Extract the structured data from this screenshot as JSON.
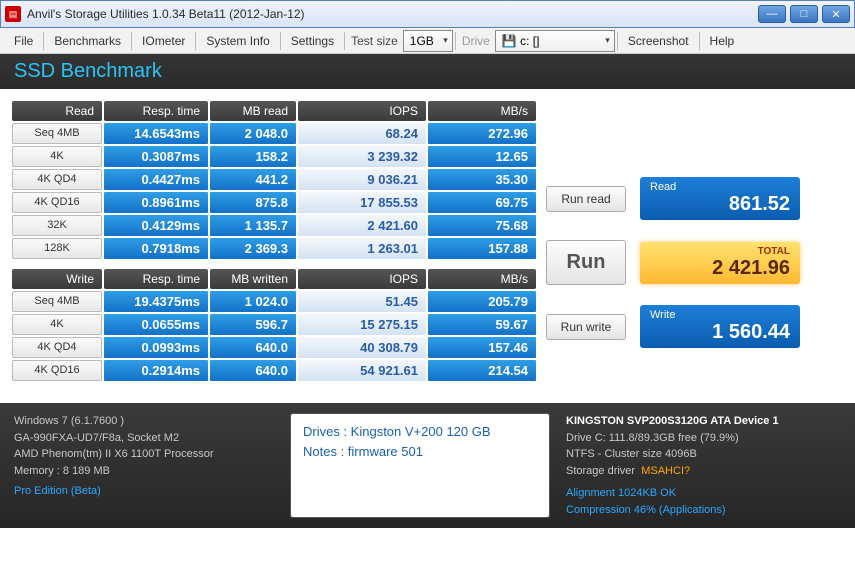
{
  "window": {
    "title": "Anvil's Storage Utilities 1.0.34 Beta11 (2012-Jan-12)"
  },
  "menu": {
    "file": "File",
    "benchmarks": "Benchmarks",
    "iometer": "IOmeter",
    "sysinfo": "System Info",
    "settings": "Settings",
    "testsize_label": "Test size",
    "testsize_value": "1GB",
    "drive_label": "Drive",
    "drive_value": "💾 c: []",
    "screenshot": "Screenshot",
    "help": "Help"
  },
  "section_title": "SSD Benchmark",
  "read_table": {
    "headers": {
      "c0": "Read",
      "c1": "Resp. time",
      "c2": "MB read",
      "c3": "IOPS",
      "c4": "MB/s"
    },
    "rows": [
      {
        "label": "Seq 4MB",
        "resp": "14.6543ms",
        "mb": "2 048.0",
        "iops": "68.24",
        "mbs": "272.96"
      },
      {
        "label": "4K",
        "resp": "0.3087ms",
        "mb": "158.2",
        "iops": "3 239.32",
        "mbs": "12.65"
      },
      {
        "label": "4K QD4",
        "resp": "0.4427ms",
        "mb": "441.2",
        "iops": "9 036.21",
        "mbs": "35.30"
      },
      {
        "label": "4K QD16",
        "resp": "0.8961ms",
        "mb": "875.8",
        "iops": "17 855.53",
        "mbs": "69.75"
      },
      {
        "label": "32K",
        "resp": "0.4129ms",
        "mb": "1 135.7",
        "iops": "2 421.60",
        "mbs": "75.68"
      },
      {
        "label": "128K",
        "resp": "0.7918ms",
        "mb": "2 369.3",
        "iops": "1 263.01",
        "mbs": "157.88"
      }
    ]
  },
  "write_table": {
    "headers": {
      "c0": "Write",
      "c1": "Resp. time",
      "c2": "MB written",
      "c3": "IOPS",
      "c4": "MB/s"
    },
    "rows": [
      {
        "label": "Seq 4MB",
        "resp": "19.4375ms",
        "mb": "1 024.0",
        "iops": "51.45",
        "mbs": "205.79"
      },
      {
        "label": "4K",
        "resp": "0.0655ms",
        "mb": "596.7",
        "iops": "15 275.15",
        "mbs": "59.67"
      },
      {
        "label": "4K QD4",
        "resp": "0.0993ms",
        "mb": "640.0",
        "iops": "40 308.79",
        "mbs": "157.46"
      },
      {
        "label": "4K QD16",
        "resp": "0.2914ms",
        "mb": "640.0",
        "iops": "54 921.61",
        "mbs": "214.54"
      }
    ]
  },
  "buttons": {
    "run_read": "Run read",
    "run": "Run",
    "run_write": "Run write"
  },
  "scores": {
    "read_label": "Read",
    "read_value": "861.52",
    "total_label": "TOTAL",
    "total_value": "2 421.96",
    "write_label": "Write",
    "write_value": "1 560.44"
  },
  "footer": {
    "os": "Windows 7 (6.1.7600 )",
    "mobo": "GA-990FXA-UD7/F8a, Socket M2",
    "cpu": "AMD Phenom(tm) II X6 1100T Processor",
    "mem": "Memory : 8 189 MB",
    "edition": "Pro Edition (Beta)",
    "drives_line": "Drives : Kingston V+200 120 GB",
    "notes_line": "Notes : firmware 501",
    "dev_name": "KINGSTON SVP200S3120G ATA Device 1",
    "dev_cap": "Drive C: 111.8/89.3GB free (79.9%)",
    "dev_fs": "NTFS - Cluster size 4096B",
    "storage_driver_label": "Storage driver",
    "storage_driver": "MSAHCI?",
    "alignment": "Alignment 1024KB OK",
    "compression": "Compression 46% (Applications)"
  }
}
